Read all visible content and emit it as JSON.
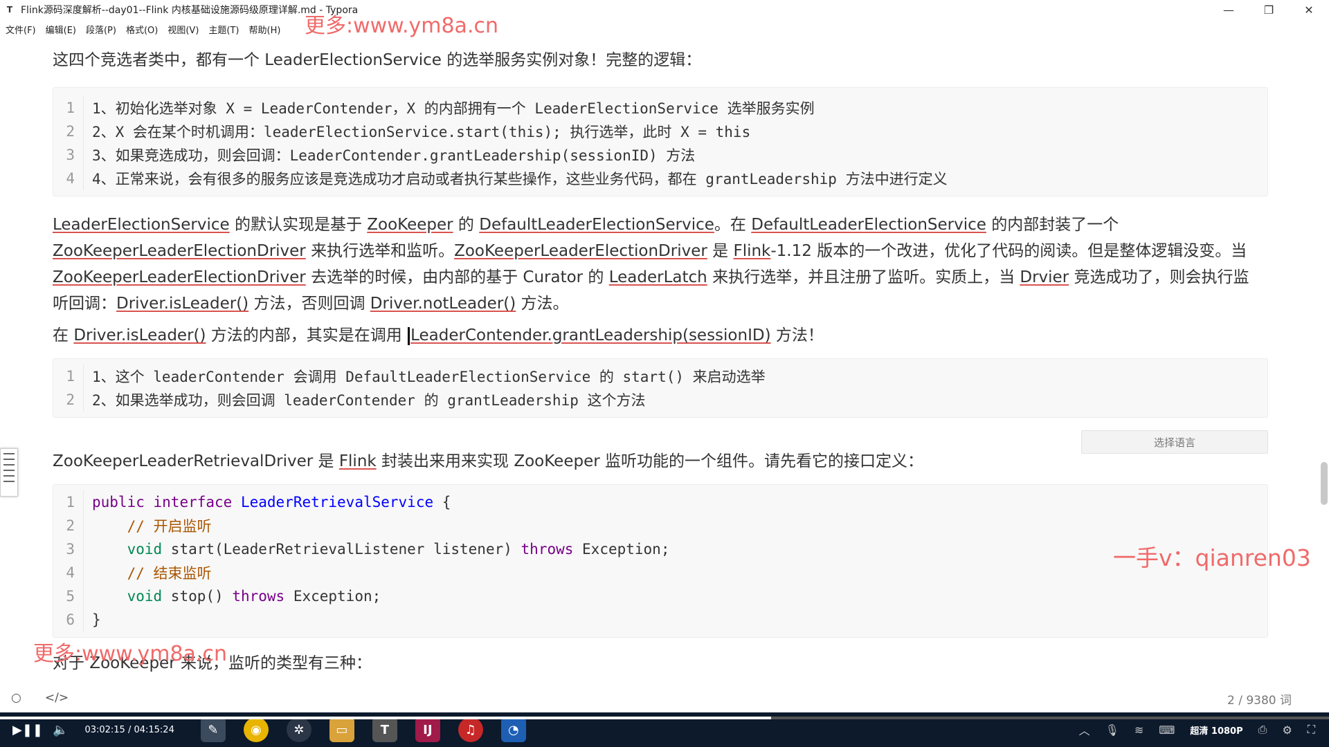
{
  "window": {
    "title": "Flink源码深度解析--day01--Flink 内核基础设施源码级原理详解.md - Typora",
    "app_icon": "T",
    "minimize": "—",
    "maximize": "❐",
    "close": "✕"
  },
  "menu": [
    "文件(F)",
    "编辑(E)",
    "段落(P)",
    "格式(O)",
    "视图(V)",
    "主题(T)",
    "帮助(H)"
  ],
  "watermarks": {
    "top": "更多:www.ym8a.cn",
    "bottom": "更多:www.ym8a.cn",
    "right": "一手v：qianren03"
  },
  "doc": {
    "intro": "这四个竞选者类中，都有一个 LeaderElectionService 的选举服务实例对象！完整的逻辑：",
    "code1": [
      {
        "n": "1",
        "text": "1、初始化选举对象 X = LeaderContender，X 的内部拥有一个 LeaderElectionService 选举服务实例"
      },
      {
        "n": "2",
        "text": "2、X 会在某个时机调用：leaderElectionService.start(this); 执行选举，此时 X = this"
      },
      {
        "n": "3",
        "text": "3、如果竞选成功，则会回调：LeaderContender.grantLeadership(sessionID) 方法"
      },
      {
        "n": "4",
        "text": "4、正常来说，会有很多的服务应该是竞选成功才启动或者执行某些操作，这些业务代码，都在 grantLeadership 方法中进行定义"
      }
    ],
    "p2": {
      "a": "LeaderElectionService",
      "b": " 的默认实现是基于 ",
      "c": "ZooKeeper",
      "d": " 的 ",
      "e": "DefaultLeaderElectionService",
      "f": "。在 ",
      "g": "DefaultLeaderElectionService",
      "h": " 的内部封装了一个",
      "i": "ZooKeeperLeaderElectionDriver",
      "j": " 来执行选举和监听。",
      "k": "ZooKeeperLeaderElectionDriver",
      "l": " 是 ",
      "m": "Flink",
      "n": "-1.12 版本的一个改进，优化了代码的阅读。但是整体逻辑没变。当",
      "o": "ZooKeeperLeaderElectionDriver",
      "p": " 去选举的时候，由内部的基于 Curator 的 ",
      "q": "LeaderLatch",
      "r": " 来执行选举，并且注册了监听。实质上，当 ",
      "s": "Drvier",
      "t": " 竞选成功了，则会执行监",
      "u": "听回调：",
      "v": "Driver.isLeader()",
      "w": " 方法，否则回调 ",
      "x": "Driver.notLeader()",
      "y": " 方法。"
    },
    "p3": {
      "a": "在 ",
      "b": "Driver.isLeader()",
      "c": " 方法的内部，其实是在调用 ",
      "d": "LeaderContender.grantLeadership(sessionID)",
      "e": " 方法！"
    },
    "code2": [
      {
        "n": "1",
        "text": "1、这个 leaderContender 会调用 DefaultLeaderElectionService 的 start() 来启动选举"
      },
      {
        "n": "2",
        "text": "2、如果选举成功，则会回调 leaderContender 的 grantLeadership 这个方法"
      }
    ],
    "lang_select": "选择语言",
    "p4": {
      "a": "ZooKeeperLeaderRetrievalDriver 是 ",
      "b": "Flink",
      "c": " 封装出来用来实现 ZooKeeper 监听功能的一个组件。请先看它的接口定义："
    },
    "code3": {
      "l1": {
        "n": "1",
        "kw1": "public",
        "kw2": "interface",
        "name": "LeaderRetrievalService",
        "rest": " {"
      },
      "l2": {
        "n": "2",
        "comment": "    // 开启监听"
      },
      "l3": {
        "n": "3",
        "ty": "void",
        "mid": " start(LeaderRetrievalListener listener) ",
        "kw": "throws",
        "end": " Exception;"
      },
      "l4": {
        "n": "4",
        "comment": "    // 结束监听"
      },
      "l5": {
        "n": "5",
        "ty": "void",
        "mid": " stop() ",
        "kw": "throws",
        "end": " Exception;"
      },
      "l6": {
        "n": "6",
        "text": "}"
      }
    },
    "p5": "对于 ZooKeeper 来说，监听的类型有三种："
  },
  "status": {
    "word_count": "2 / 9380 词",
    "left_icon": "○",
    "source_icon": "</>"
  },
  "taskbar": {
    "time": "03:02:15 / 04:15:24",
    "quality": "超清 1080P",
    "progress_fraction": 0.58
  }
}
